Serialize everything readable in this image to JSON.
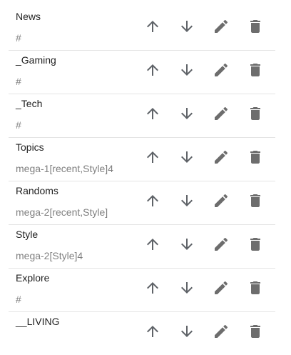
{
  "items": [
    {
      "name": "News",
      "url": "#"
    },
    {
      "name": "_Gaming",
      "url": "#"
    },
    {
      "name": "_Tech",
      "url": "#"
    },
    {
      "name": "Topics",
      "url": "mega-1[recent,Style]4"
    },
    {
      "name": "Randoms",
      "url": "mega-2[recent,Style]"
    },
    {
      "name": "Style",
      "url": "mega-2[Style]4"
    },
    {
      "name": "Explore",
      "url": "#"
    },
    {
      "name": "__LIVING",
      "url": ""
    }
  ],
  "icons": {
    "move_up": "arrow-up-icon",
    "move_down": "arrow-down-icon",
    "edit": "pencil-icon",
    "delete": "trash-icon"
  },
  "colors": {
    "icon": "#5f6368",
    "title": "#222222",
    "subtitle": "#808080",
    "divider": "#e4e4e4"
  }
}
